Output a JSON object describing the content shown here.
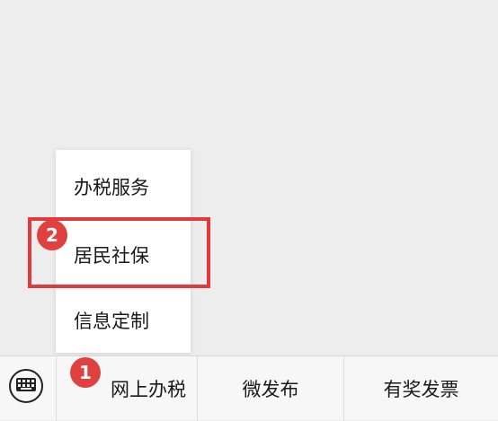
{
  "popup_menu": {
    "items": [
      {
        "label": "办税服务"
      },
      {
        "label": "居民社保"
      },
      {
        "label": "信息定制"
      }
    ]
  },
  "annotations": {
    "step1": "1",
    "step2": "2",
    "highlight_color": "#e23a3a",
    "badge_color": "#e0403f"
  },
  "bottom_bar": {
    "keyboard_icon": "keyboard-icon",
    "tabs": [
      {
        "label": "网上办税"
      },
      {
        "label": "微发布"
      },
      {
        "label": "有奖发票"
      }
    ]
  }
}
